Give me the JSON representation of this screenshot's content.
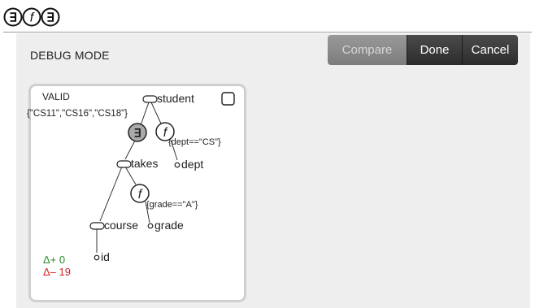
{
  "app": {
    "logo_glyphs": [
      "∃",
      "f",
      "∃"
    ]
  },
  "debug": {
    "mode_label": "DEBUG MODE"
  },
  "toolbar": {
    "compare_label": "Compare",
    "done_label": "Done",
    "cancel_label": "Cancel"
  },
  "query": {
    "status": "VALID",
    "exists_symbol": "∃",
    "filter_symbol": "f",
    "nodes": {
      "student": "student",
      "dept": "dept",
      "takes": "takes",
      "course": "course",
      "grade": "grade",
      "id": "id"
    },
    "annotations": {
      "course_values": "{\"CS11\",\"CS16\",\"CS18\"}",
      "dept_filter": "{dept==\"CS\"}",
      "grade_filter": "{grade==\"A\"}"
    },
    "delta_plus": "Δ+ 0",
    "delta_minus": "Δ– 19"
  },
  "colors": {
    "delta_plus": "#2e8b2e",
    "delta_minus": "#d42020",
    "card_border": "#cfcfcf"
  }
}
